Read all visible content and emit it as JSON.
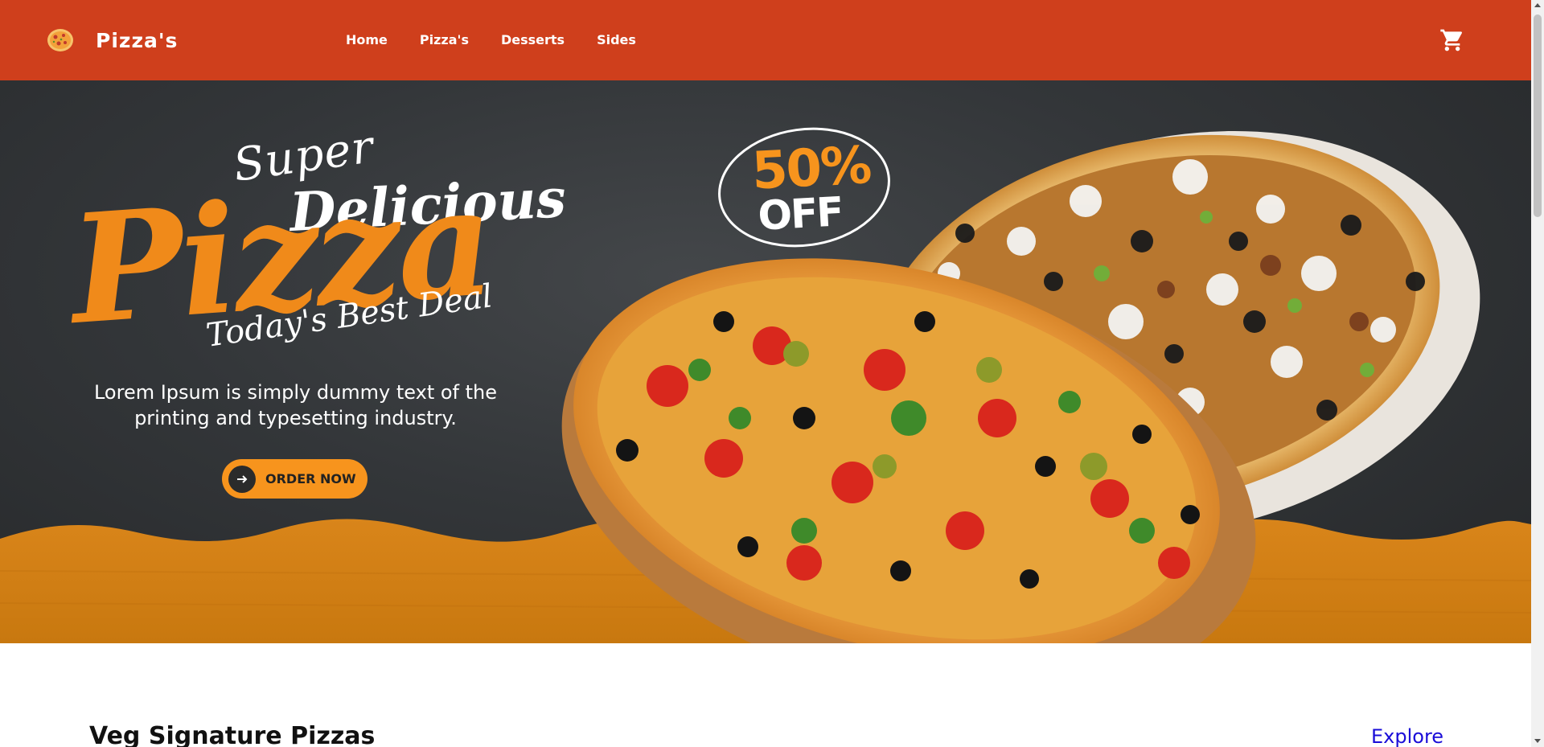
{
  "navbar": {
    "brand": "Pizza's",
    "logo_icon": "pizza-slice-icon",
    "links": [
      "Home",
      "Pizza's",
      "Desserts",
      "Sides"
    ],
    "cart_icon": "shopping-cart-icon",
    "background": "#cf3f1c"
  },
  "hero": {
    "title_super": "Super",
    "title_delicious": "Delicious",
    "title_pizza": "Pizza",
    "title_deal": "Today's Best Deal",
    "description": "Lorem Ipsum is simply dummy text of the printing and typesetting industry.",
    "order_button": "ORDER NOW",
    "order_button_icon": "arrow-right-icon",
    "badge_percent": "50%",
    "badge_off": "OFF",
    "accent": "#f7941d"
  },
  "section": {
    "title": "Veg Signature Pizzas",
    "explore": "Explore"
  }
}
